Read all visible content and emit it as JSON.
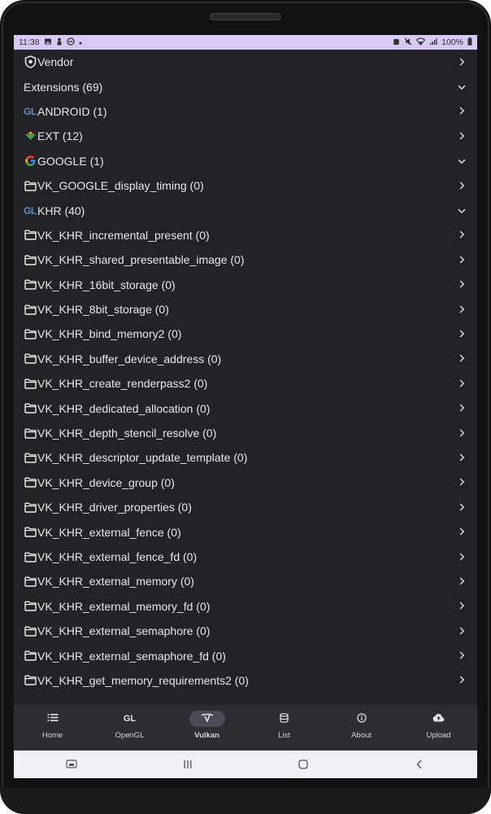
{
  "status_bar": {
    "time": "11:38",
    "battery": "100%"
  },
  "list": [
    {
      "label": "Vendor",
      "icon": "shield-icon",
      "chevron": "right"
    },
    {
      "label": "Extensions (69)",
      "icon": "",
      "chevron": "down"
    },
    {
      "label": "ANDROID (1)",
      "icon": "gl-icon",
      "icon_text": "GL",
      "chevron": "right"
    },
    {
      "label": "EXT (12)",
      "icon": "ext-icon",
      "chevron": "right"
    },
    {
      "label": "GOOGLE (1)",
      "icon": "google-icon",
      "chevron": "down"
    },
    {
      "label": "VK_GOOGLE_display_timing (0)",
      "icon": "folder-icon",
      "chevron": "right"
    },
    {
      "label": "KHR (40)",
      "icon": "gl-icon",
      "icon_text": "GL",
      "chevron": "down"
    },
    {
      "label": "VK_KHR_incremental_present (0)",
      "icon": "folder-icon",
      "chevron": "right"
    },
    {
      "label": "VK_KHR_shared_presentable_image (0)",
      "icon": "folder-icon",
      "chevron": "right"
    },
    {
      "label": "VK_KHR_16bit_storage (0)",
      "icon": "folder-icon",
      "chevron": "right"
    },
    {
      "label": "VK_KHR_8bit_storage (0)",
      "icon": "folder-icon",
      "chevron": "right"
    },
    {
      "label": "VK_KHR_bind_memory2 (0)",
      "icon": "folder-icon",
      "chevron": "right"
    },
    {
      "label": "VK_KHR_buffer_device_address (0)",
      "icon": "folder-icon",
      "chevron": "right"
    },
    {
      "label": "VK_KHR_create_renderpass2 (0)",
      "icon": "folder-icon",
      "chevron": "right"
    },
    {
      "label": "VK_KHR_dedicated_allocation (0)",
      "icon": "folder-icon",
      "chevron": "right"
    },
    {
      "label": "VK_KHR_depth_stencil_resolve (0)",
      "icon": "folder-icon",
      "chevron": "right"
    },
    {
      "label": "VK_KHR_descriptor_update_template (0)",
      "icon": "folder-icon",
      "chevron": "right"
    },
    {
      "label": "VK_KHR_device_group (0)",
      "icon": "folder-icon",
      "chevron": "right"
    },
    {
      "label": "VK_KHR_driver_properties (0)",
      "icon": "folder-icon",
      "chevron": "right"
    },
    {
      "label": "VK_KHR_external_fence (0)",
      "icon": "folder-icon",
      "chevron": "right"
    },
    {
      "label": "VK_KHR_external_fence_fd (0)",
      "icon": "folder-icon",
      "chevron": "right"
    },
    {
      "label": "VK_KHR_external_memory (0)",
      "icon": "folder-icon",
      "chevron": "right"
    },
    {
      "label": "VK_KHR_external_memory_fd (0)",
      "icon": "folder-icon",
      "chevron": "right"
    },
    {
      "label": "VK_KHR_external_semaphore (0)",
      "icon": "folder-icon",
      "chevron": "right"
    },
    {
      "label": "VK_KHR_external_semaphore_fd (0)",
      "icon": "folder-icon",
      "chevron": "right"
    },
    {
      "label": "VK_KHR_get_memory_requirements2 (0)",
      "icon": "folder-icon",
      "chevron": "right"
    }
  ],
  "bottom_nav": [
    {
      "label": "Home",
      "icon": "list-icon"
    },
    {
      "label": "OpenGL",
      "icon": "gl-icon",
      "icon_text": "GL"
    },
    {
      "label": "Vulkan",
      "icon": "vulkan-icon",
      "active": true
    },
    {
      "label": "List",
      "icon": "database-icon"
    },
    {
      "label": "About",
      "icon": "info-icon"
    },
    {
      "label": "Upload",
      "icon": "cloud-upload-icon"
    }
  ],
  "colors": {
    "background": "#232227",
    "status_bar": "#d7c8f5",
    "nav_active_pill": "#4c4a56",
    "text": "#e9e7ee"
  }
}
